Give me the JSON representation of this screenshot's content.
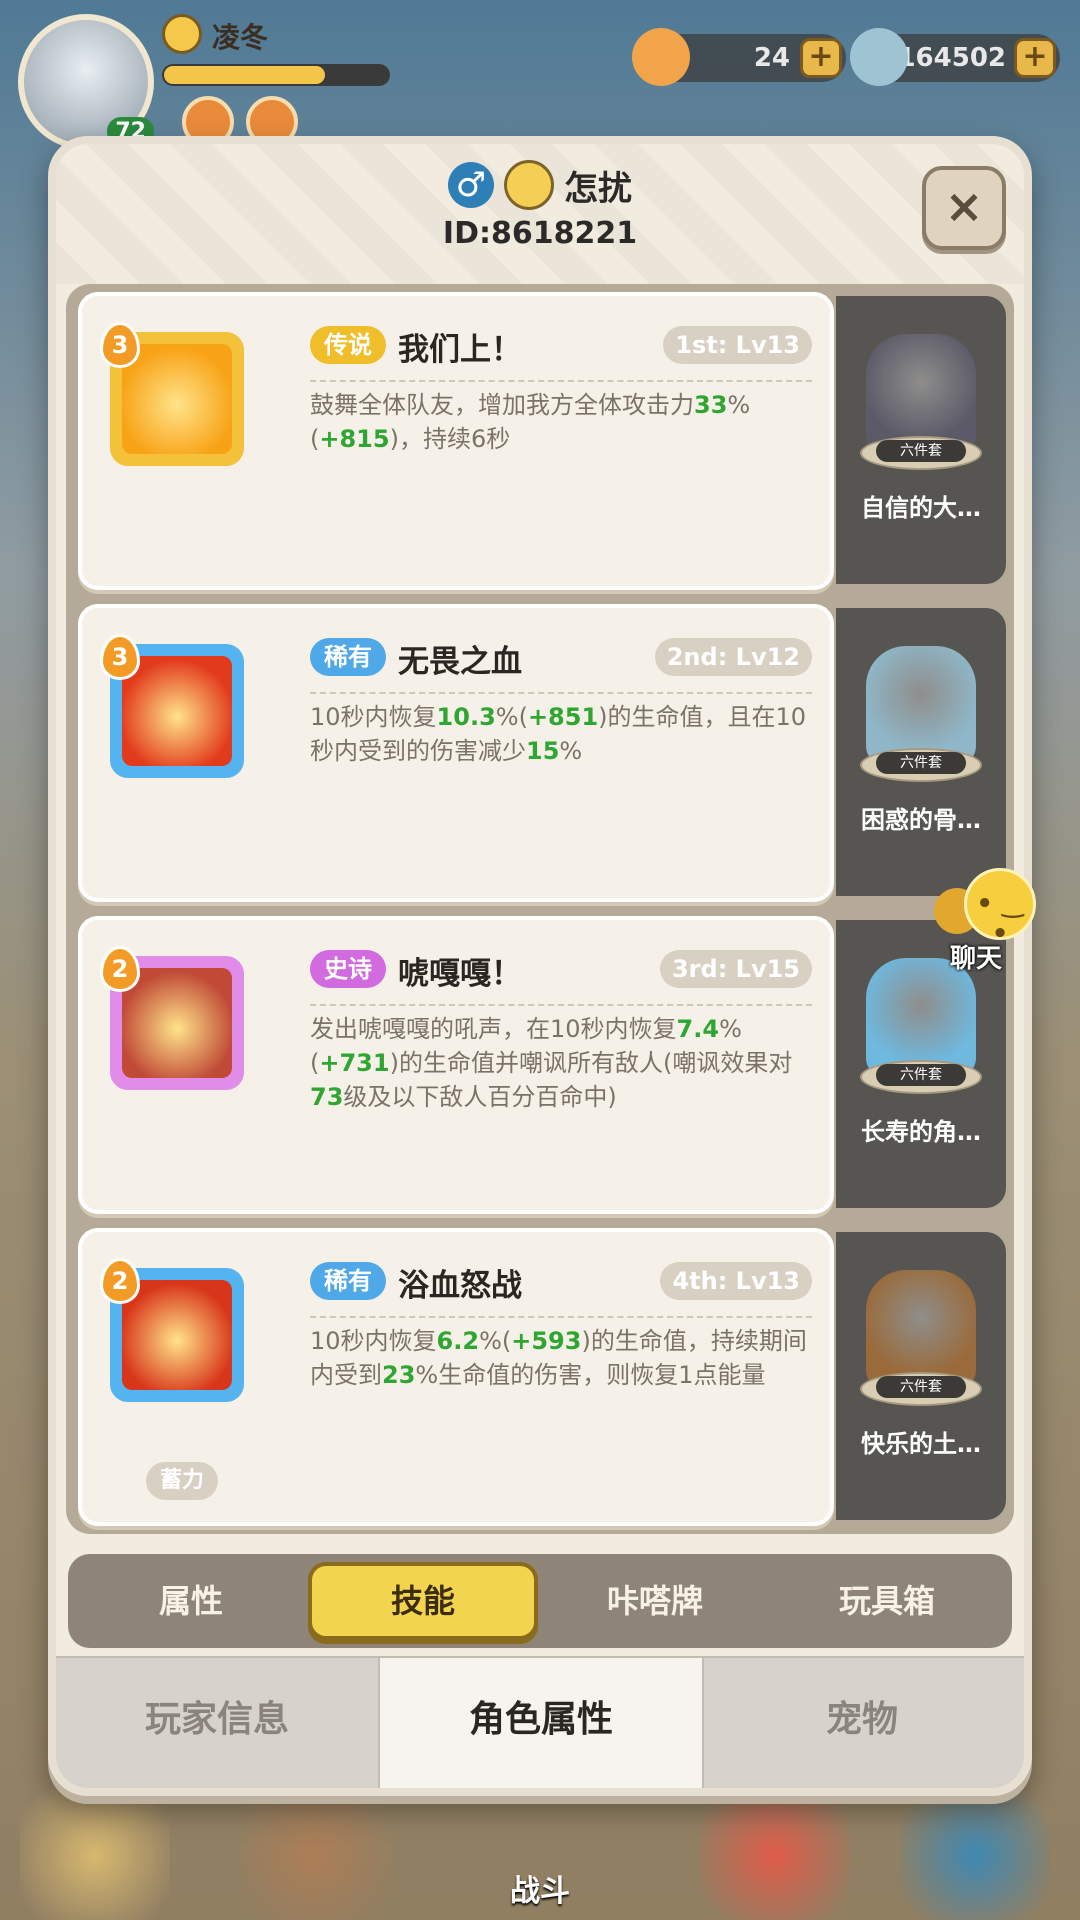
{
  "hud": {
    "player_name": "凌冬",
    "level": "72",
    "exp_fraction": 0.72,
    "resource1": "24",
    "resource2": "164502"
  },
  "bottom_nav": {
    "battle": "战斗"
  },
  "dialog": {
    "name": "怎扰",
    "id": "ID:8618221",
    "close": "×"
  },
  "skills": [
    {
      "level": "3",
      "rarity": "传说",
      "rarity_color": "#f0bd2b",
      "icon_color": "#f8a317",
      "frame_color": "#f4c13a",
      "name": "我们上！",
      "rank": "1st: Lv13",
      "desc": [
        {
          "t": "鼓舞全体队友，增加我方全体攻击力"
        },
        {
          "t": "33",
          "hl": true
        },
        {
          "t": "%("
        },
        {
          "t": "+815",
          "hl": true
        },
        {
          "t": ")，持续6秒"
        }
      ],
      "toy_name": "自信的大…",
      "toy_color": "#5c5a68"
    },
    {
      "level": "3",
      "rarity": "稀有",
      "rarity_color": "#4fa8e8",
      "icon_color": "#e23a1c",
      "frame_color": "#55b4ef",
      "name": "无畏之血",
      "rank": "2nd: Lv12",
      "desc": [
        {
          "t": "10秒内恢复"
        },
        {
          "t": "10.3",
          "hl": true
        },
        {
          "t": "%("
        },
        {
          "t": "+851",
          "hl": true
        },
        {
          "t": ")的生命值，且在10秒内受到的伤害减少"
        },
        {
          "t": "15",
          "hl": true
        },
        {
          "t": "%"
        }
      ],
      "toy_name": "困惑的骨…",
      "toy_color": "#8fb7c9"
    },
    {
      "level": "2",
      "rarity": "史诗",
      "rarity_color": "#d36be0",
      "icon_color": "#c04a36",
      "frame_color": "#e08ce8",
      "name": "唬嘎嘎！",
      "rank": "3rd: Lv15",
      "desc": [
        {
          "t": "发出唬嘎嘎的吼声，在10秒内恢复"
        },
        {
          "t": "7.4",
          "hl": true
        },
        {
          "t": "%("
        },
        {
          "t": "+731",
          "hl": true
        },
        {
          "t": ")的生命值并嘲讽所有敌人(嘲讽效果对"
        },
        {
          "t": "73",
          "hl": true
        },
        {
          "t": "级及以下敌人百分百命中)"
        }
      ],
      "toy_name": "长寿的角…",
      "toy_color": "#6fb8de"
    },
    {
      "level": "2",
      "rarity": "稀有",
      "rarity_color": "#4fa8e8",
      "icon_color": "#d8361a",
      "frame_color": "#55b4ef",
      "name": "浴血怒战",
      "rank": "4th: Lv13",
      "desc": [
        {
          "t": "10秒内恢复"
        },
        {
          "t": "6.2",
          "hl": true
        },
        {
          "t": "%("
        },
        {
          "t": "+593",
          "hl": true
        },
        {
          "t": ")的生命值，持续期间内受到"
        },
        {
          "t": "23",
          "hl": true
        },
        {
          "t": "%生命值的伤害，则恢复1点能量"
        }
      ],
      "charge_tag": "蓄力",
      "toy_name": "快乐的土…",
      "toy_color": "#9a6a3a"
    }
  ],
  "toy_set_tag": "六件套",
  "tabs": [
    "属性",
    "技能",
    "咔嗒牌",
    "玩具箱"
  ],
  "active_tab": 1,
  "segments": [
    "玩家信息",
    "角色属性",
    "宠物"
  ],
  "active_segment": 1,
  "chat_label": "聊天"
}
